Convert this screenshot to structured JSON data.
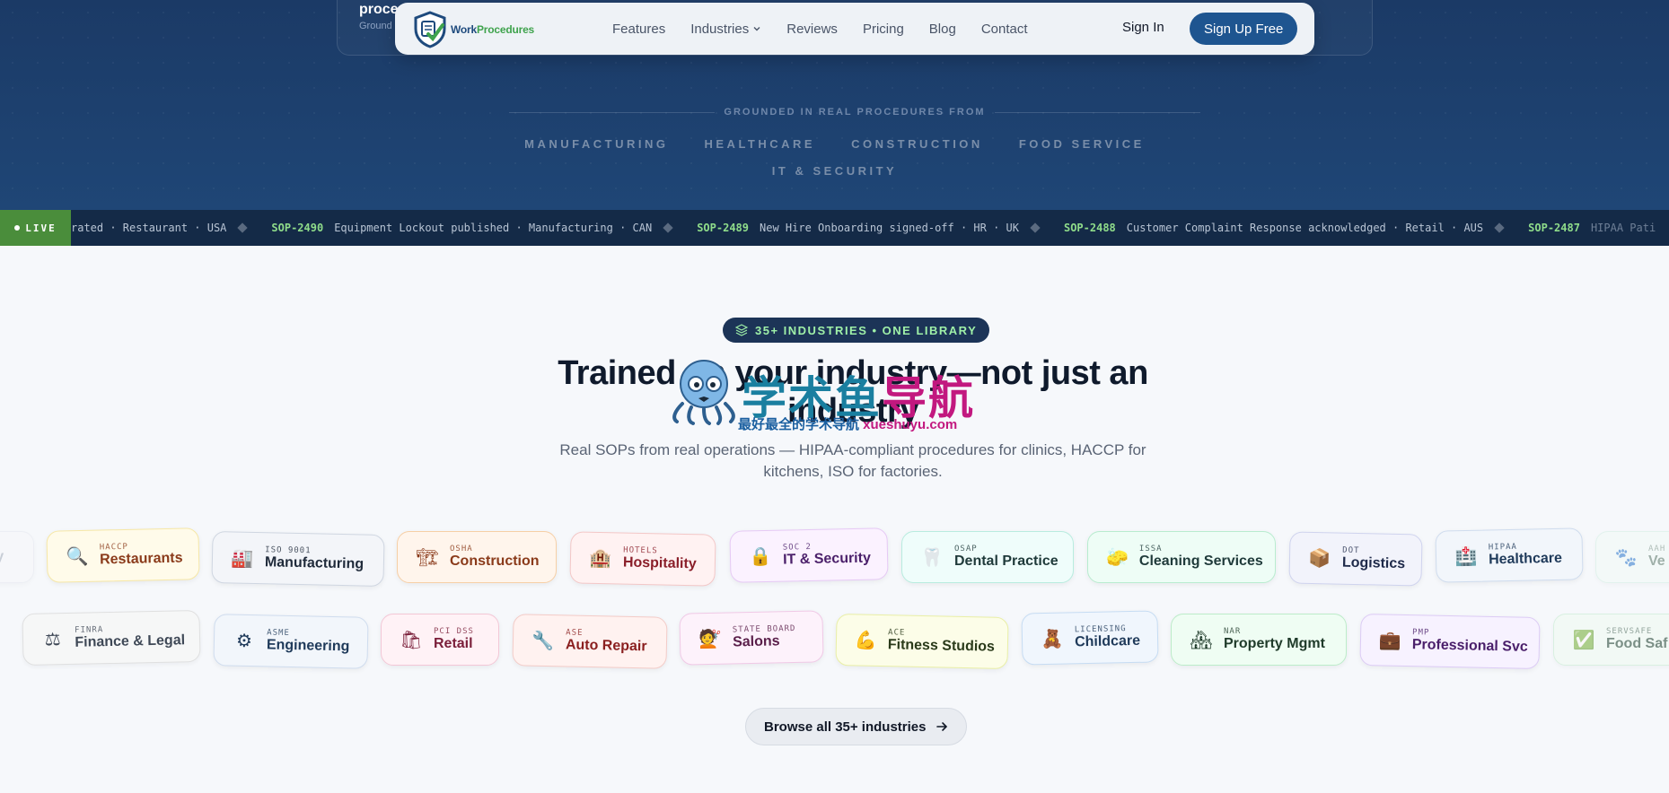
{
  "hero": {
    "ghost_title": "proce",
    "ghost_sub": "Ground",
    "grounded_label": "GROUNDED IN REAL PROCEDURES FROM",
    "industries_row1": [
      "MANUFACTURING",
      "HEALTHCARE",
      "CONSTRUCTION",
      "FOOD SERVICE"
    ],
    "industries_row2": [
      "IT & SECURITY"
    ]
  },
  "nav": {
    "logo_part1": "Work",
    "logo_part2": "Procedures",
    "links": [
      "Features",
      "Industries",
      "Reviews",
      "Pricing",
      "Blog",
      "Contact"
    ],
    "sign_in": "Sign In",
    "sign_up": "Sign Up Free"
  },
  "ticker": {
    "live_label": "LIVE",
    "items": [
      {
        "id": "",
        "text": "rated · Restaurant · USA"
      },
      {
        "id": "SOP-2490",
        "text": "Equipment Lockout published · Manufacturing · CAN"
      },
      {
        "id": "SOP-2489",
        "text": "New Hire Onboarding signed-off · HR · UK"
      },
      {
        "id": "SOP-2488",
        "text": "Customer Complaint Response acknowledged · Retail · AUS"
      },
      {
        "id": "SOP-2487",
        "text": "HIPAA Pati"
      }
    ]
  },
  "main": {
    "badge": "35+ INDUSTRIES • ONE LIBRARY",
    "headline": "Trained on your industry—not just an industry",
    "subtext": "Real SOPs from real operations — HIPAA-compliant procedures for clinics, HACCP for kitchens, ISO for factories.",
    "browse_label": "Browse all 35+ industries"
  },
  "pills_row1": [
    {
      "tag": "",
      "name": "ry",
      "icon": "🔎"
    },
    {
      "tag": "HACCP",
      "name": "Restaurants",
      "icon": "🔍"
    },
    {
      "tag": "ISO 9001",
      "name": "Manufacturing",
      "icon": "🏭"
    },
    {
      "tag": "OSHA",
      "name": "Construction",
      "icon": "🏗"
    },
    {
      "tag": "HOTELS",
      "name": "Hospitality",
      "icon": "🏨"
    },
    {
      "tag": "SOC 2",
      "name": "IT & Security",
      "icon": "🔒"
    },
    {
      "tag": "OSAP",
      "name": "Dental Practice",
      "icon": "🦷"
    },
    {
      "tag": "ISSA",
      "name": "Cleaning Services",
      "icon": "🧽"
    },
    {
      "tag": "DOT",
      "name": "Logistics",
      "icon": "📦"
    },
    {
      "tag": "HIPAA",
      "name": "Healthcare",
      "icon": "🏥"
    },
    {
      "tag": "AAH",
      "name": "Ve",
      "icon": "🐾"
    }
  ],
  "pills_row2": [
    {
      "tag": "FINRA",
      "name": "Finance & Legal",
      "icon": "⚖"
    },
    {
      "tag": "ASME",
      "name": "Engineering",
      "icon": "⚙"
    },
    {
      "tag": "PCI DSS",
      "name": "Retail",
      "icon": "🛍"
    },
    {
      "tag": "ASE",
      "name": "Auto Repair",
      "icon": "🔧"
    },
    {
      "tag": "STATE BOARD",
      "name": "Salons",
      "icon": "💇"
    },
    {
      "tag": "ACE",
      "name": "Fitness Studios",
      "icon": "💪"
    },
    {
      "tag": "LICENSING",
      "name": "Childcare",
      "icon": "🧸"
    },
    {
      "tag": "NAR",
      "name": "Property Mgmt",
      "icon": "🏘"
    },
    {
      "tag": "PMP",
      "name": "Professional Svc",
      "icon": "💼"
    },
    {
      "tag": "SERVSAFE",
      "name": "Food Saf",
      "icon": "✅"
    }
  ],
  "watermark": {
    "main_a": "学术鱼",
    "main_b": "导航",
    "sub_a": "最好最全的学术导航 ",
    "sub_b": "xueshuyu.com"
  },
  "colors": {
    "hero_bg": "#1b3a66",
    "signup_bg": "#1e5590",
    "live_bg": "#4a8d3b",
    "ticker_id": "#8fdc8a"
  }
}
